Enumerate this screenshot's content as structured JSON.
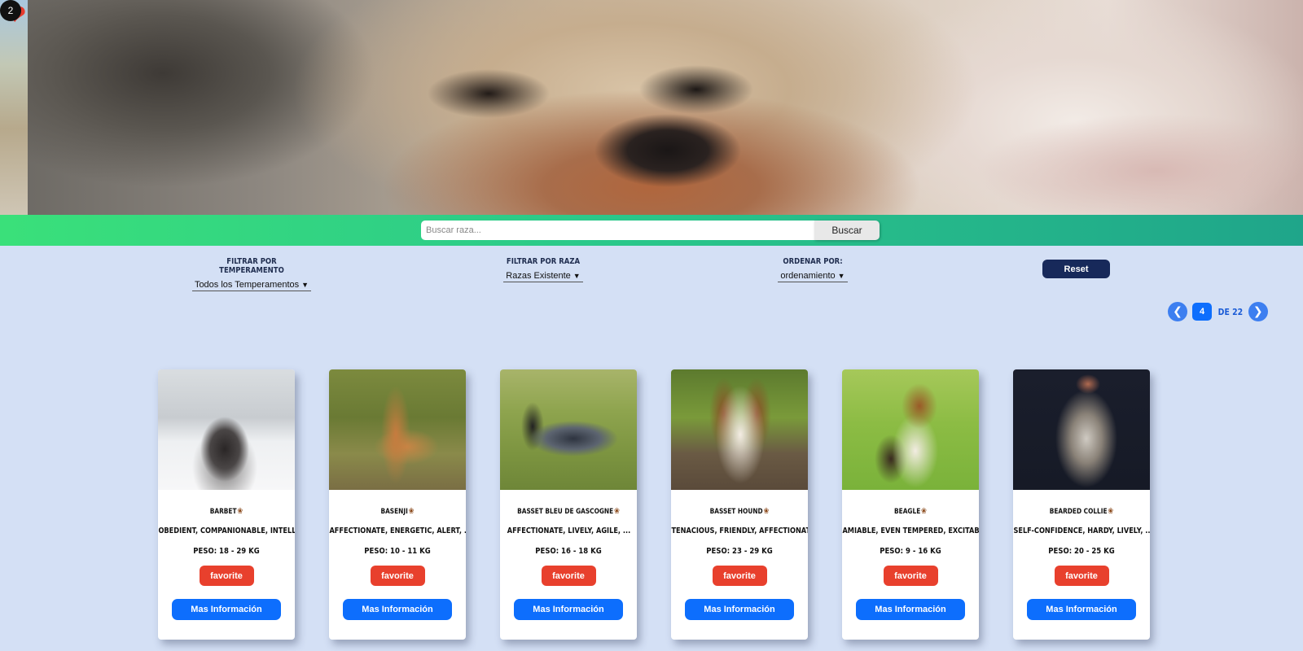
{
  "favorites": {
    "count": "2",
    "icon": "heart-icon"
  },
  "search": {
    "placeholder": "Buscar raza...",
    "button_label": "Buscar"
  },
  "filters": {
    "temperament": {
      "label": "FILTRAR POR TEMPERAMENTO",
      "selected": "Todos los Temperamentos"
    },
    "breed": {
      "label": "FILTRAR POR RAZA",
      "selected": "Razas Existente"
    },
    "order": {
      "label": "ORDENAR POR:",
      "selected": "ordenamiento"
    },
    "reset_label": "Reset"
  },
  "pagination": {
    "prev_icon": "chevron-left-icon",
    "next_icon": "chevron-right-icon",
    "current": "4",
    "of_label": "DE 22"
  },
  "cards": [
    {
      "name": "BARBET",
      "temperament": "OBEDIENT, COMPANIONABLE, INTELLIGENT, ...",
      "weight": "PESO: 18 - 29 KG",
      "fav_label": "favorite",
      "info_label": "Mas Información"
    },
    {
      "name": "BASENJI",
      "temperament": "AFFECTIONATE, ENERGETIC, ALERT, ...",
      "weight": "PESO: 10 - 11 KG",
      "fav_label": "favorite",
      "info_label": "Mas Información"
    },
    {
      "name": "BASSET BLEU DE GASCOGNE",
      "temperament": "AFFECTIONATE, LIVELY, AGILE, ...",
      "weight": "PESO: 16 - 18 KG",
      "fav_label": "favorite",
      "info_label": "Mas Información"
    },
    {
      "name": "BASSET HOUND",
      "temperament": "TENACIOUS, FRIENDLY, AFFECTIONATE, ...",
      "weight": "PESO: 23 - 29 KG",
      "fav_label": "favorite",
      "info_label": "Mas Información"
    },
    {
      "name": "BEAGLE",
      "temperament": "AMIABLE, EVEN TEMPERED, EXCITABLE, ...",
      "weight": "PESO: 9 - 16 KG",
      "fav_label": "favorite",
      "info_label": "Mas Información"
    },
    {
      "name": "BEARDED COLLIE",
      "temperament": "SELF-CONFIDENCE, HARDY, LIVELY, ...",
      "weight": "PESO: 20 - 25 KG",
      "fav_label": "favorite",
      "info_label": "Mas Información"
    }
  ]
}
